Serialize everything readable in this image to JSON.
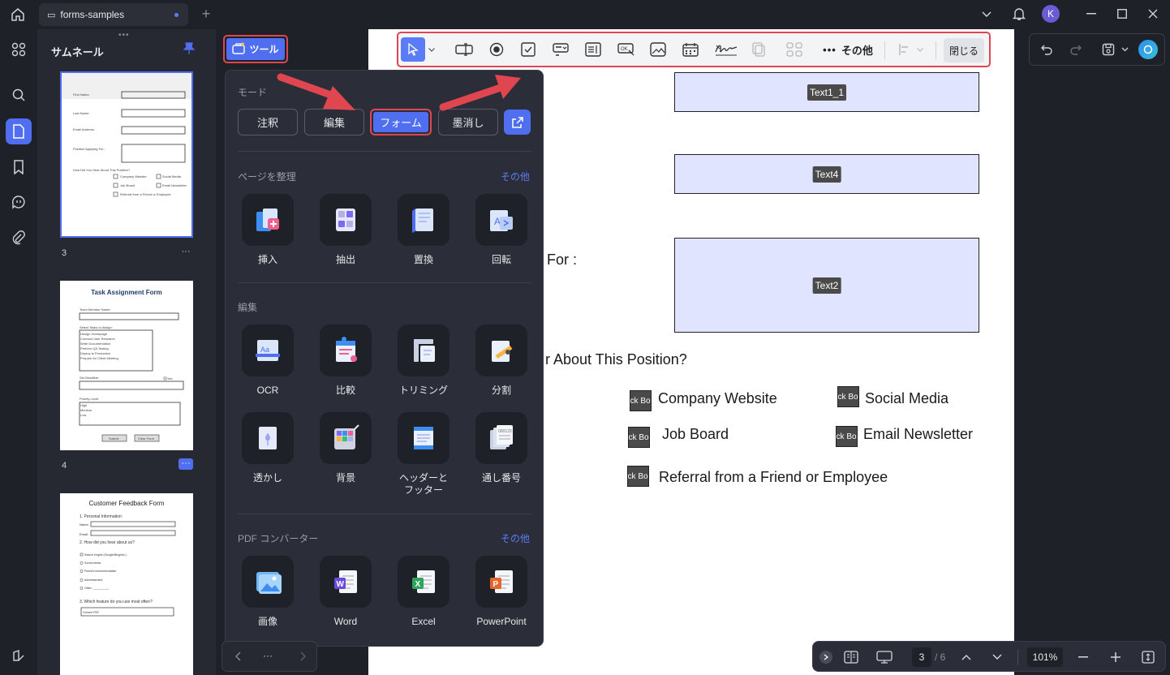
{
  "titlebar": {
    "tab_title": "forms-samples",
    "avatar_letter": "K"
  },
  "thumbs": {
    "title": "サムネール",
    "pages": [
      {
        "num": "3"
      },
      {
        "num": "4",
        "title": "Task Assignment Form"
      },
      {
        "title": "Customer Feedback Form"
      }
    ],
    "more": "···"
  },
  "tool_button": {
    "label": "ツール"
  },
  "menu": {
    "mode_label": "モード",
    "modes": [
      "注釈",
      "編集",
      "フォーム",
      "墨消し"
    ],
    "organize": {
      "label": "ページを整理",
      "more": "その他",
      "items": [
        "挿入",
        "抽出",
        "置換",
        "回転"
      ]
    },
    "edit": {
      "label": "編集",
      "items": [
        "OCR",
        "比較",
        "トリミング",
        "分割",
        "透かし",
        "背景",
        "ヘッダーと\nフッター",
        "通し番号"
      ]
    },
    "convert": {
      "label": "PDF コンバーター",
      "more": "その他",
      "items": [
        "画像",
        "Word",
        "Excel",
        "PowerPoint"
      ]
    }
  },
  "form_toolbar": {
    "more_label": "その他",
    "close_label": "閉じる"
  },
  "page": {
    "fields": [
      "Text1_1",
      "Text4",
      "Text2"
    ],
    "label_for": "For :",
    "question": "r About This Position?",
    "checkbox_text": "eck Bo",
    "options": [
      "Company Website",
      "Social Media",
      "Job Board",
      "Email Newsletter",
      "Referral from a Friend or Employee"
    ]
  },
  "pager": {
    "more": "···"
  },
  "bottom": {
    "page_current": "3",
    "page_total": "/ 6",
    "zoom": "101%"
  }
}
